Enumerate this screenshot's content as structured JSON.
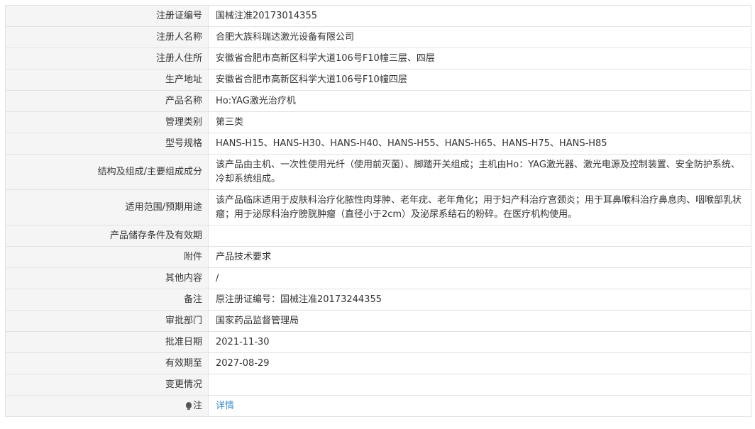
{
  "rows": [
    {
      "label": "注册证编号",
      "value": "国械注准20173014355"
    },
    {
      "label": "注册人名称",
      "value": "合肥大族科瑞达激光设备有限公司"
    },
    {
      "label": "注册人住所",
      "value": "安徽省合肥市高新区科学大道106号F10幢三层、四层"
    },
    {
      "label": "生产地址",
      "value": "安徽省合肥市高新区科学大道106号F10幢四层"
    },
    {
      "label": "产品名称",
      "value": "Ho:YAG激光治疗机"
    },
    {
      "label": "管理类别",
      "value": "第三类"
    },
    {
      "label": "型号规格",
      "value": "HANS-H15、HANS-H30、HANS-H40、HANS-H55、HANS-H65、HANS-H75、HANS-H85"
    },
    {
      "label": "结构及组成/主要组成成分",
      "value": "该产品由主机、一次性使用光纤（使用前灭菌）、脚踏开关组成；主机由Ho：YAG激光器、激光电源及控制装置、安全防护系统、冷却系统组成。"
    },
    {
      "label": "适用范围/预期用途",
      "value": "该产品临床适用于皮肤科治疗化脓性肉芽肿、老年疣、老年角化；用于妇产科治疗宫颈炎；用于耳鼻喉科治疗鼻息肉、咽喉部乳状瘤；用于泌尿科治疗膀胱肿瘤（直径小于2cm）及泌尿系结石的粉碎。在医疗机构使用。"
    },
    {
      "label": "产品储存条件及有效期",
      "value": ""
    },
    {
      "label": "附件",
      "value": "产品技术要求"
    },
    {
      "label": "其他内容",
      "value": "/"
    },
    {
      "label": "备注",
      "value": "原注册证编号：国械注准20173244355"
    },
    {
      "label": "审批部门",
      "value": "国家药品监督管理局"
    },
    {
      "label": "批准日期",
      "value": "2021-11-30"
    },
    {
      "label": "有效期至",
      "value": "2027-08-29"
    },
    {
      "label": "变更情况",
      "value": ""
    }
  ],
  "note": {
    "label": "注",
    "icon": "lightbulb-icon",
    "link_text": "详情",
    "link_color": "#3b8fd4"
  }
}
